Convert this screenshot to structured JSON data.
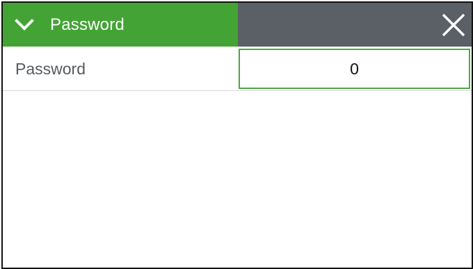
{
  "header": {
    "title": "Password",
    "toggle_icon": "chevron-down-icon",
    "close_icon": "close-icon",
    "accent_color": "#43a435",
    "bar_color": "#5a6066"
  },
  "fields": {
    "password": {
      "label": "Password",
      "value": "0"
    }
  }
}
